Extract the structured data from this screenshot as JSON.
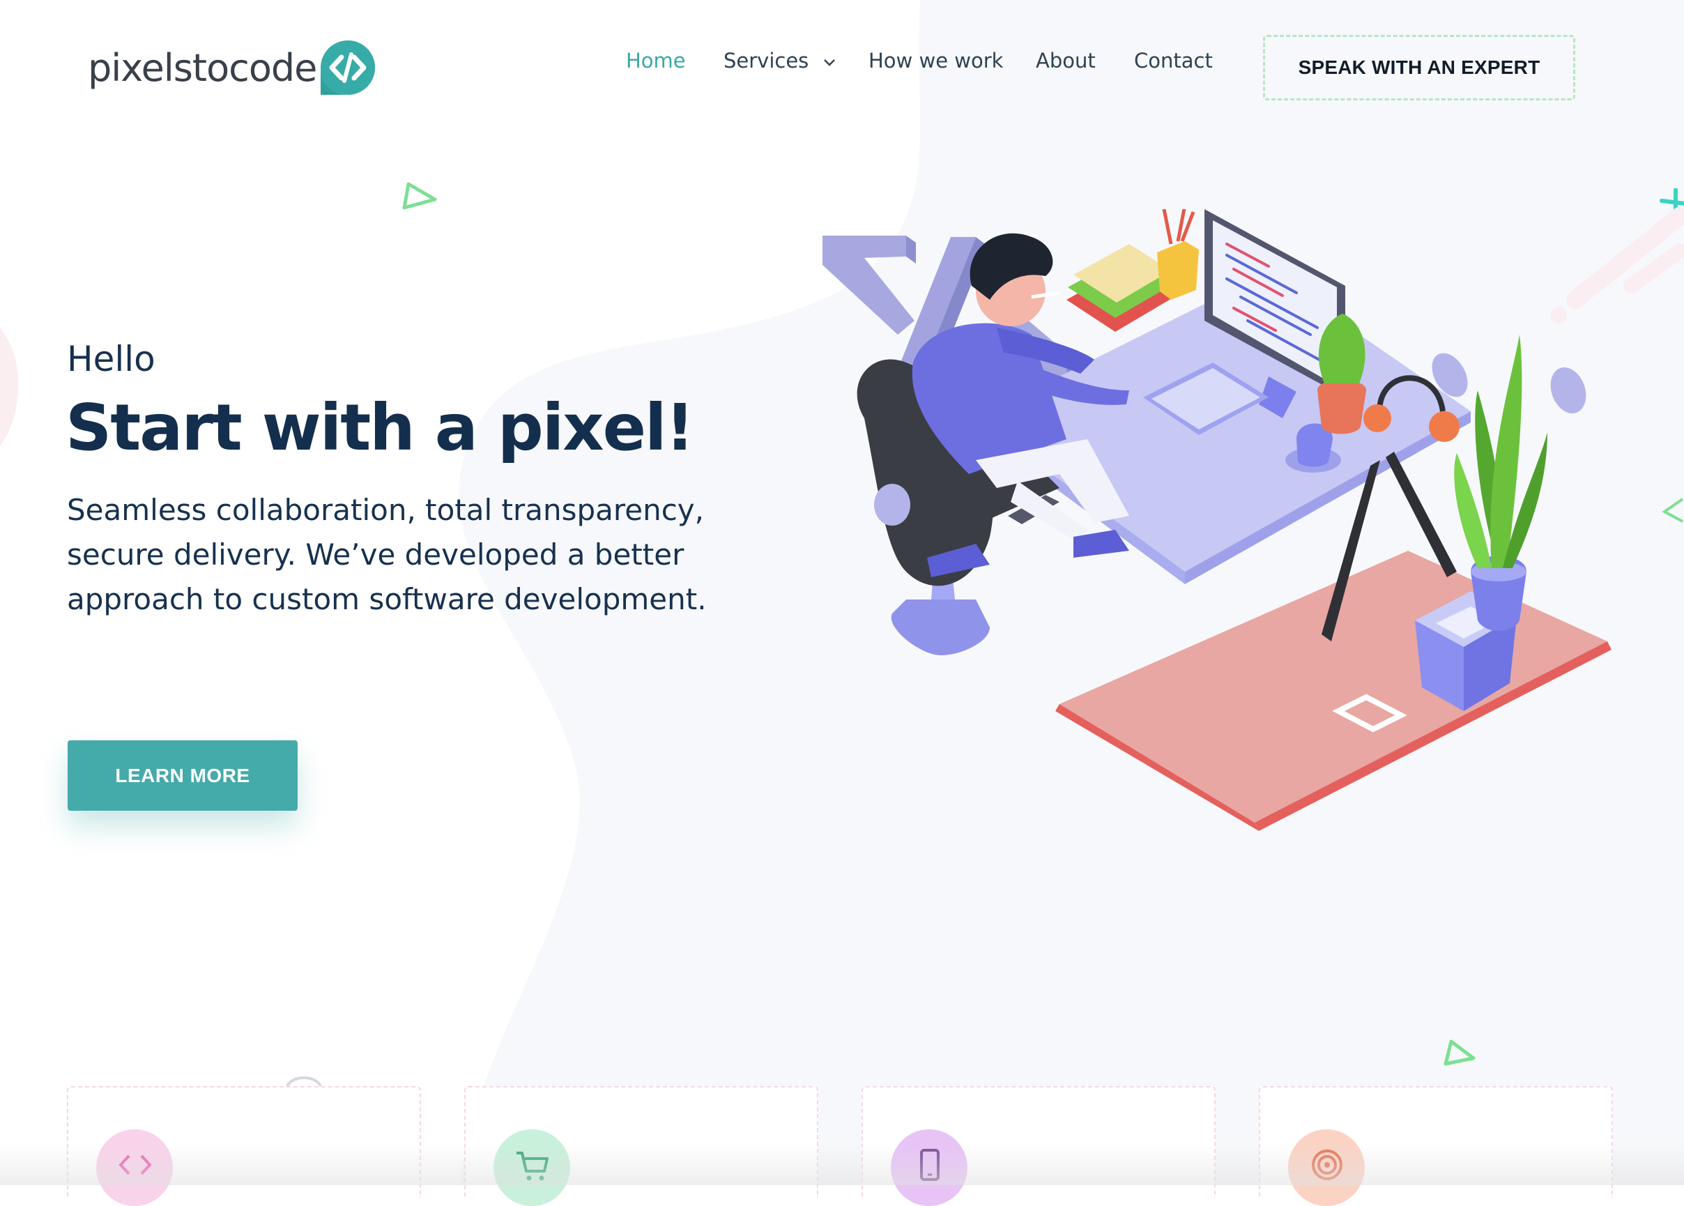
{
  "brand": {
    "name": "pixelstocode",
    "badge_color": "#3aa8a5"
  },
  "nav": {
    "items": [
      {
        "label": "Home",
        "active": true
      },
      {
        "label": "Services",
        "has_dropdown": true
      },
      {
        "label": "How we work"
      },
      {
        "label": "About"
      },
      {
        "label": "Contact"
      }
    ],
    "cta_label": "SPEAK WITH AN EXPERT",
    "active_color": "#3aa8a5"
  },
  "hero": {
    "greeting": "Hello",
    "title": "Start with a pixel!",
    "subtitle_lines": [
      "Seamless collaboration, total transparency,",
      "secure delivery. We’ve developed a better",
      "approach to custom software development."
    ],
    "button_label": "LEARN MORE",
    "button_color": "#45aaaa"
  },
  "service_cards": [
    {
      "icon": "code-icon",
      "icon_bg": "#f9d3ea",
      "icon_color": "#e568b4"
    },
    {
      "icon": "shopping-cart-icon",
      "icon_bg": "#c8f0da",
      "icon_color": "#3aa877"
    },
    {
      "icon": "mobile-phone-icon",
      "icon_bg": "#e7c3f6",
      "icon_color": "#7a4d95"
    },
    {
      "icon": "target-icon",
      "icon_bg": "#fbd3c4",
      "icon_color": "#e8745a"
    }
  ]
}
